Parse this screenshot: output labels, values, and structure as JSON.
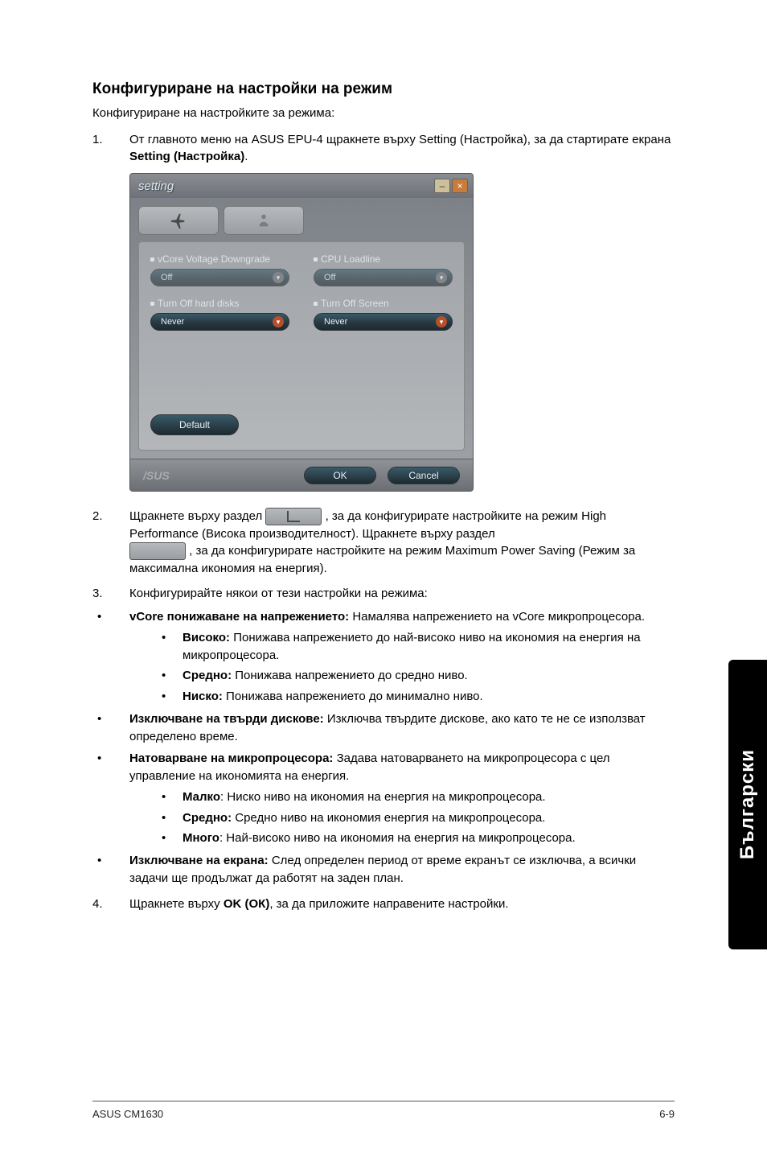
{
  "section_title": "Конфигуриране на настройки на режим",
  "intro_text": "Конфигуриране на настройките за режима:",
  "step1_num": "1.",
  "step1_a": "От главното меню на ASUS EPU-4 щракнете върху Setting (Настройка), за да стартирате екрана ",
  "step1_bold": "Setting (Настройка)",
  "step1_b": ".",
  "window": {
    "title": "setting",
    "close": "×",
    "min": "–",
    "vcore_label": "vCore Voltage Downgrade",
    "vcore_value": "Off",
    "cpu_label": "CPU Loadline",
    "cpu_value": "Off",
    "hdd_label": "Turn Off hard disks",
    "hdd_value": "Never",
    "screen_label": "Turn Off Screen",
    "screen_value": "Never",
    "default": "Default",
    "ok": "OK",
    "cancel": "Cancel",
    "logo": "/SUS"
  },
  "step2_num": "2.",
  "step2_a": "Щракнете върху раздел ",
  "step2_b": " , за да конфигурирате настройките на режим High Performance (Висока производителност). Щракнете върху раздел ",
  "step2_c": " , за да конфигурирате настройките на режим Maximum Power Saving (Режим за максимална икономия на енергия).",
  "step3_num": "3.",
  "step3": "Конфигурирайте някои от тези настройки на режима:",
  "dot": "•",
  "b1_bold": "vCore понижаване на напрежението: ",
  "b1_text": "Намалява напрежението на vCore микропроцесора.",
  "b1s1_bold": "Високо: ",
  "b1s1_text": "Понижава напрежението до най-високо ниво на икономия на енергия на микропроцесора.",
  "b1s2_bold": "Средно: ",
  "b1s2_text": "Понижава напрежението до средно ниво.",
  "b1s3_bold": "Ниско: ",
  "b1s3_text": "Понижава напрежението до минимално ниво.",
  "b2_bold": "Изключване на твърди дискове: ",
  "b2_text": "Изключва твърдите дискове, ако като те не се използват определено време.",
  "b3_bold": "Натоварване на микропроцесора: ",
  "b3_text": "Задава натоварването на микропроцесора с цел управление на икономията на енергия.",
  "b3s1_bold": "Малко",
  "b3s1_text": ": Ниско ниво на икономия на енергия на микропроцесора.",
  "b3s2_bold": "Средно: ",
  "b3s2_text": "Средно ниво на икономия енергия на микропроцесора.",
  "b3s3_bold": "Много",
  "b3s3_text": ": Най-високо ниво на икономия на енергия на микропроцесора.",
  "b4_bold": "Изключване на екрана: ",
  "b4_text": "След определен период от време екранът се изключва, а всички задачи ще продължат да работят на заден план.",
  "step4_num": "4.",
  "step4_a": "Щракнете върху ",
  "step4_bold": "OK (ОК)",
  "step4_b": ", за да приложите направените настройки.",
  "side_tab": "Български",
  "footer_left": "ASUS CM1630",
  "footer_right": "6-9"
}
